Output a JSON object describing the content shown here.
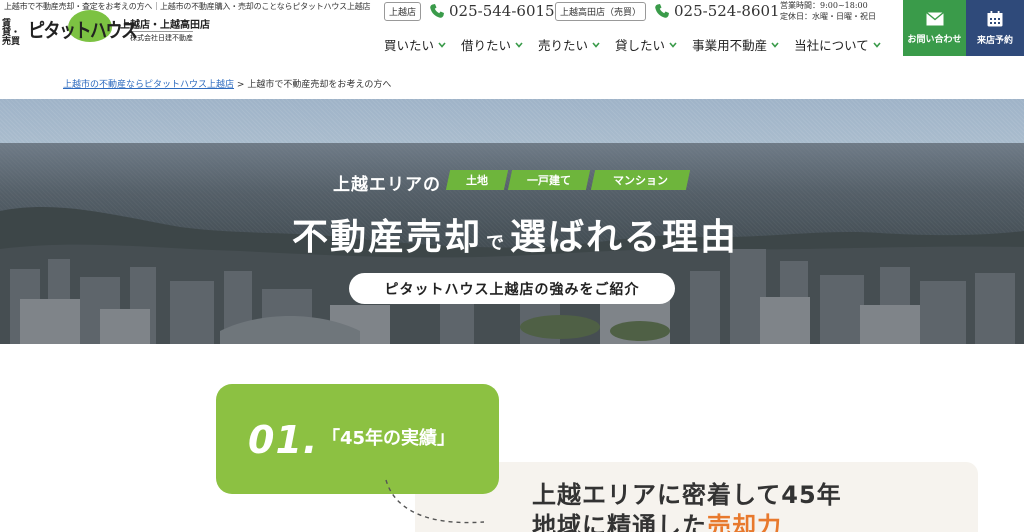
{
  "header": {
    "tagline": "上越市で不動産売却・査定をお考えの方へ｜上越市の不動産購入・売却のことならピタットハウス上越店",
    "logo": {
      "left_text": "賃貸・売買",
      "brand": "ピタットハウス",
      "store": "上越店・上越高田店",
      "company": "株式会社日建不動産"
    },
    "phones": [
      {
        "store": "上越店",
        "number": "025-544-6015"
      },
      {
        "store": "上越高田店（売買）",
        "number": "025-524-8601"
      }
    ],
    "hours_line1": "営業時間：9:00~18:00",
    "hours_line2": "定休日：水曜・日曜・祝日",
    "nav": [
      "買いたい",
      "借りたい",
      "売りたい",
      "貸したい",
      "事業用不動産",
      "当社について"
    ],
    "cta_contact": "お問い合わせ",
    "cta_visit": "来店予約",
    "colors": {
      "contact_bg": "#3a9b4a",
      "visit_bg": "#2f4a7a",
      "nav_chevron": "#3a9b4a"
    }
  },
  "breadcrumb": {
    "home": "上越市の不動産ならピタットハウス上越店",
    "separator": ">",
    "current": "上越市で不動産売却をお考えの方へ"
  },
  "hero": {
    "area": "上越エリアの",
    "tags": [
      "土地",
      "一戸建て",
      "マンション"
    ],
    "title_part1": "不動産売却",
    "title_small": "で",
    "title_part2": "選ばれる理由",
    "pill": "ピタットハウス上越店の強みをご紹介",
    "accent": "#6eb53c"
  },
  "point": {
    "number": "01.",
    "label": "「45年の実績」",
    "headline1": "上越エリアに密着して45年",
    "headline2_prefix": "地域に精通した",
    "headline2_accent": "売却力",
    "box_color": "#8cc142",
    "accent_color": "#e8792d"
  }
}
